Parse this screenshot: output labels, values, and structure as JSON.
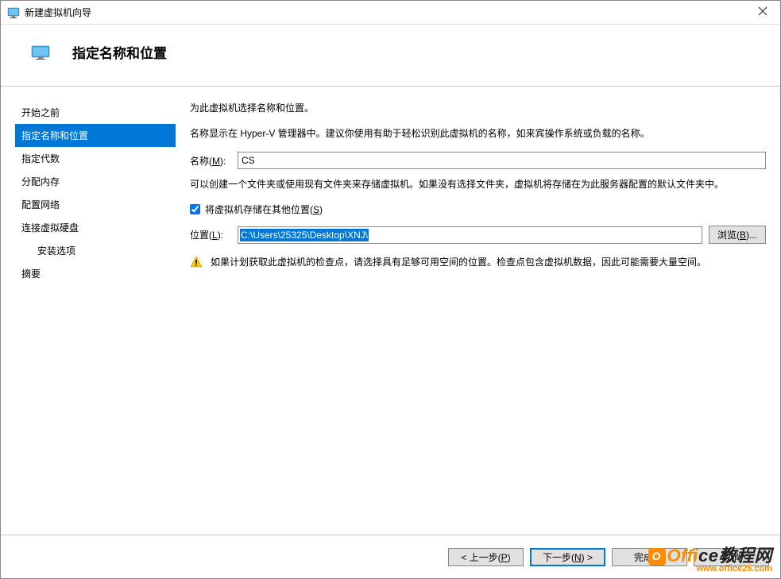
{
  "titlebar": {
    "title": "新建虚拟机向导"
  },
  "header": {
    "title": "指定名称和位置"
  },
  "sidebar": {
    "items": [
      {
        "label": "开始之前",
        "selected": false
      },
      {
        "label": "指定名称和位置",
        "selected": true
      },
      {
        "label": "指定代数",
        "selected": false
      },
      {
        "label": "分配内存",
        "selected": false
      },
      {
        "label": "配置网络",
        "selected": false
      },
      {
        "label": "连接虚拟硬盘",
        "selected": false
      },
      {
        "label": "安装选项",
        "selected": false,
        "indented": true
      },
      {
        "label": "摘要",
        "selected": false
      }
    ]
  },
  "main": {
    "intro": "为此虚拟机选择名称和位置。",
    "desc1": "名称显示在 Hyper-V 管理器中。建议你使用有助于轻松识别此虚拟机的名称，如来宾操作系统或负载的名称。",
    "name_label_prefix": "名称(",
    "name_label_key": "M",
    "name_label_suffix": "):",
    "name_value": "CS",
    "desc2": "可以创建一个文件夹或使用现有文件夹来存储虚拟机。如果没有选择文件夹，虚拟机将存储在为此服务器配置的默认文件夹中。",
    "checkbox_label_prefix": "将虚拟机存储在其他位置(",
    "checkbox_label_key": "S",
    "checkbox_label_suffix": ")",
    "checkbox_checked": true,
    "location_label_prefix": "位置(",
    "location_label_key": "L",
    "location_label_suffix": "):",
    "location_value": "C:\\Users\\25325\\Desktop\\XNJ\\",
    "browse_prefix": "浏览(",
    "browse_key": "B",
    "browse_suffix": ")...",
    "warning": "如果计划获取此虚拟机的检查点，请选择具有足够可用空间的位置。检查点包含虚拟机数据，因此可能需要大量空间。"
  },
  "footer": {
    "prev_prefix": "< 上一步(",
    "prev_key": "P",
    "prev_suffix": ")",
    "next_prefix": "下一步(",
    "next_key": "N",
    "next_suffix": ") >",
    "finish_prefix": "完成(",
    "finish_key": "F",
    "finish_suffix": ")",
    "cancel": "取消"
  },
  "watermark": {
    "brand_highlight": "Offi",
    "brand_rest": "ce教程网",
    "url": "www.office26.com"
  },
  "icons": {
    "app": "monitor-icon",
    "header": "monitor-icon",
    "close": "close-icon",
    "warning": "warning-triangle-icon"
  }
}
